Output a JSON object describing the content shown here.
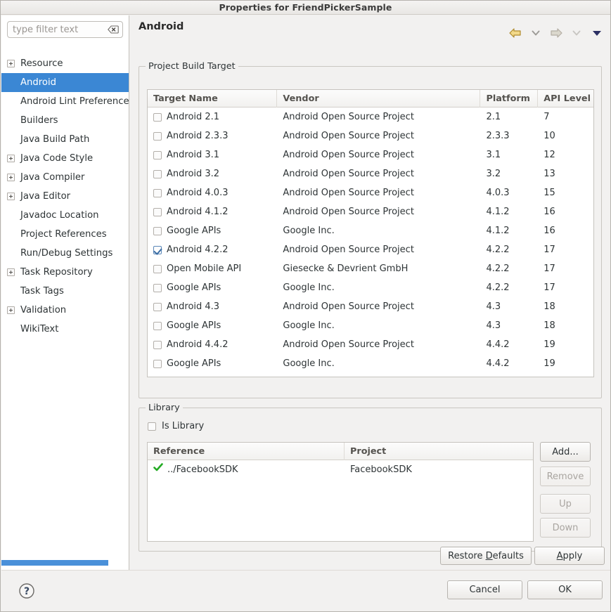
{
  "window": {
    "title": "Properties for FriendPickerSample"
  },
  "sidebar": {
    "filter": {
      "value": "",
      "placeholder": "type filter text",
      "clear_icon": "clear-backspace-icon"
    },
    "items": [
      {
        "label": "Resource",
        "expandable": true,
        "selected": false
      },
      {
        "label": "Android",
        "expandable": false,
        "selected": true
      },
      {
        "label": "Android Lint Preferences",
        "expandable": false,
        "selected": false
      },
      {
        "label": "Builders",
        "expandable": false,
        "selected": false
      },
      {
        "label": "Java Build Path",
        "expandable": false,
        "selected": false
      },
      {
        "label": "Java Code Style",
        "expandable": true,
        "selected": false
      },
      {
        "label": "Java Compiler",
        "expandable": true,
        "selected": false
      },
      {
        "label": "Java Editor",
        "expandable": true,
        "selected": false
      },
      {
        "label": "Javadoc Location",
        "expandable": false,
        "selected": false
      },
      {
        "label": "Project References",
        "expandable": false,
        "selected": false
      },
      {
        "label": "Run/Debug Settings",
        "expandable": false,
        "selected": false
      },
      {
        "label": "Task Repository",
        "expandable": true,
        "selected": false
      },
      {
        "label": "Task Tags",
        "expandable": false,
        "selected": false
      },
      {
        "label": "Validation",
        "expandable": true,
        "selected": false
      },
      {
        "label": "WikiText",
        "expandable": false,
        "selected": false
      }
    ],
    "scrollbar_color": "#4a90d9"
  },
  "page": {
    "title": "Android",
    "nav": [
      {
        "name": "back-arrow-icon",
        "enabled": true
      },
      {
        "name": "back-history-chevron-icon",
        "enabled": true
      },
      {
        "name": "forward-arrow-icon",
        "enabled": false
      },
      {
        "name": "forward-history-chevron-icon",
        "enabled": false
      },
      {
        "name": "view-menu-triangle-icon",
        "enabled": true
      }
    ]
  },
  "build_target": {
    "legend": "Project Build Target",
    "columns": [
      "Target Name",
      "Vendor",
      "Platform",
      "API Level"
    ],
    "rows": [
      {
        "checked": false,
        "name": "Android 2.1",
        "vendor": "Android Open Source Project",
        "platform": "2.1",
        "api": "7"
      },
      {
        "checked": false,
        "name": "Android 2.3.3",
        "vendor": "Android Open Source Project",
        "platform": "2.3.3",
        "api": "10"
      },
      {
        "checked": false,
        "name": "Android 3.1",
        "vendor": "Android Open Source Project",
        "platform": "3.1",
        "api": "12"
      },
      {
        "checked": false,
        "name": "Android 3.2",
        "vendor": "Android Open Source Project",
        "platform": "3.2",
        "api": "13"
      },
      {
        "checked": false,
        "name": "Android 4.0.3",
        "vendor": "Android Open Source Project",
        "platform": "4.0.3",
        "api": "15"
      },
      {
        "checked": false,
        "name": "Android 4.1.2",
        "vendor": "Android Open Source Project",
        "platform": "4.1.2",
        "api": "16"
      },
      {
        "checked": false,
        "name": "Google APIs",
        "vendor": "Google Inc.",
        "platform": "4.1.2",
        "api": "16"
      },
      {
        "checked": true,
        "name": "Android 4.2.2",
        "vendor": "Android Open Source Project",
        "platform": "4.2.2",
        "api": "17"
      },
      {
        "checked": false,
        "name": "Open Mobile API",
        "vendor": "Giesecke & Devrient GmbH",
        "platform": "4.2.2",
        "api": "17"
      },
      {
        "checked": false,
        "name": "Google APIs",
        "vendor": "Google Inc.",
        "platform": "4.2.2",
        "api": "17"
      },
      {
        "checked": false,
        "name": "Android 4.3",
        "vendor": "Android Open Source Project",
        "platform": "4.3",
        "api": "18"
      },
      {
        "checked": false,
        "name": "Google APIs",
        "vendor": "Google Inc.",
        "platform": "4.3",
        "api": "18"
      },
      {
        "checked": false,
        "name": "Android 4.4.2",
        "vendor": "Android Open Source Project",
        "platform": "4.4.2",
        "api": "19"
      },
      {
        "checked": false,
        "name": "Google APIs",
        "vendor": "Google Inc.",
        "platform": "4.4.2",
        "api": "19"
      }
    ]
  },
  "library": {
    "legend": "Library",
    "is_library_label": "Is Library",
    "is_library_checked": false,
    "columns": [
      "Reference",
      "Project"
    ],
    "rows": [
      {
        "status_icon": "green-check-icon",
        "reference": "../FacebookSDK",
        "project": "FacebookSDK"
      }
    ],
    "buttons": [
      {
        "label": "Add...",
        "enabled": true
      },
      {
        "label": "Remove",
        "enabled": false
      },
      {
        "label": "Up",
        "enabled": false
      },
      {
        "label": "Down",
        "enabled": false
      }
    ]
  },
  "footer": {
    "restore_defaults": {
      "pre": "Restore ",
      "mnemonic": "D",
      "post": "efaults"
    },
    "apply": {
      "pre": "",
      "mnemonic": "A",
      "post": "pply"
    },
    "cancel": "Cancel",
    "ok": "OK",
    "help_icon": "help-question-icon"
  },
  "colors": {
    "selection": "#3b87d4",
    "scrollbar": "#4a90d9",
    "green_check": "#2aad2a",
    "back_arrow": "#e8c55a"
  }
}
